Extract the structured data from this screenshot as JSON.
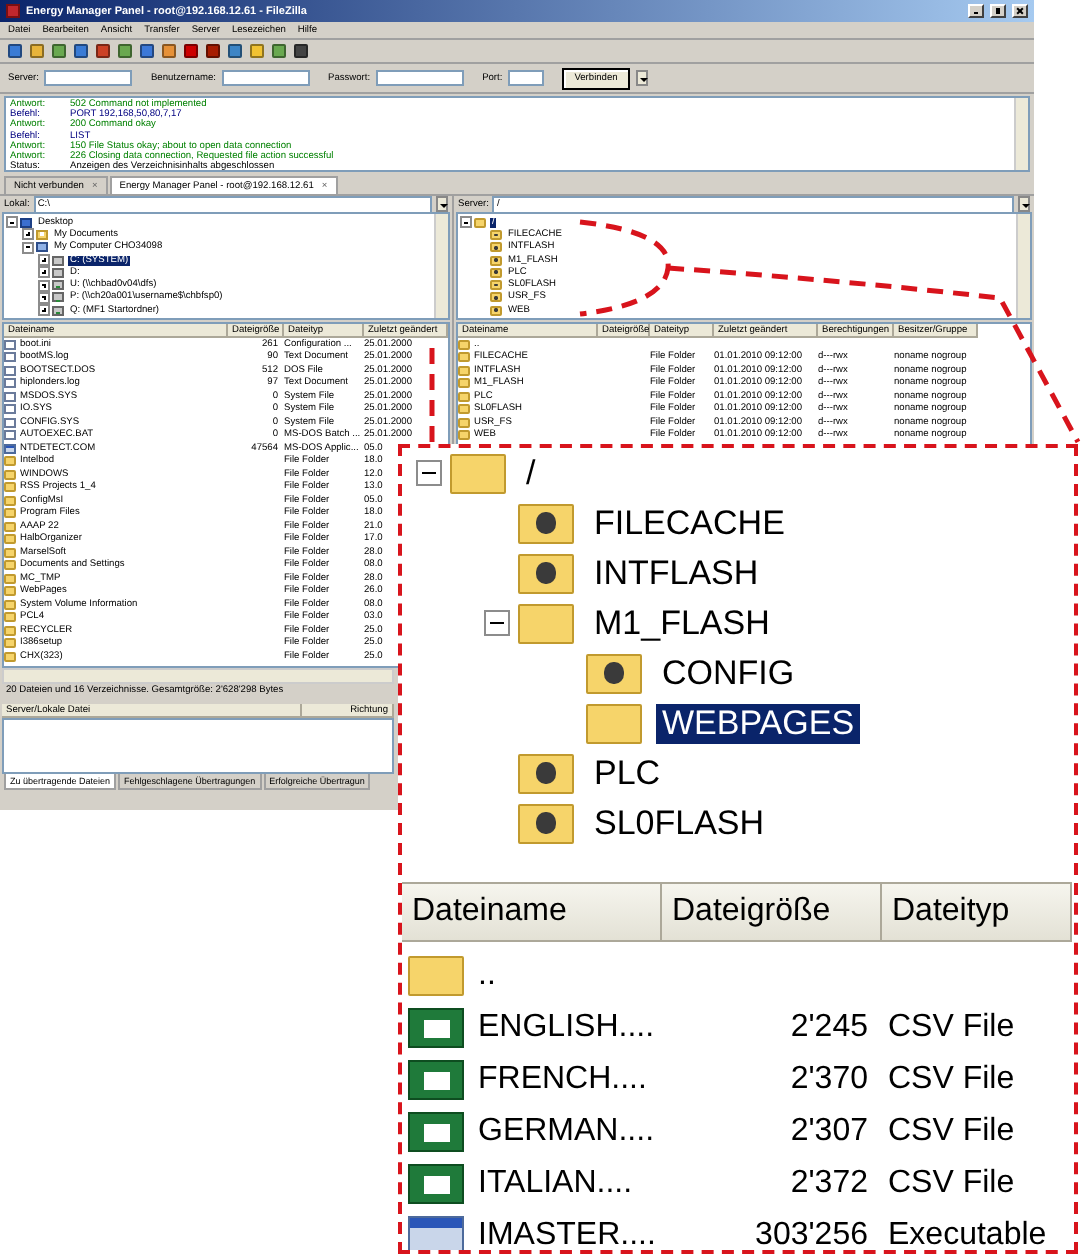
{
  "window": {
    "title": "Energy Manager Panel - root@192.168.12.61 - FileZilla"
  },
  "menu": [
    "Datei",
    "Bearbeiten",
    "Ansicht",
    "Transfer",
    "Server",
    "Lesezeichen",
    "Hilfe"
  ],
  "quickconnect": {
    "fields": [
      {
        "label": "Server:"
      },
      {
        "label": "Benutzername:"
      },
      {
        "label": "Passwort:"
      },
      {
        "label": "Port:"
      }
    ],
    "button": "Verbinden"
  },
  "log": [
    {
      "kind": "response",
      "label": "Antwort:",
      "text": "502 Command not implemented"
    },
    {
      "kind": "command",
      "label": "Befehl:",
      "text": "PORT 192,168,50,80,7,17"
    },
    {
      "kind": "response",
      "label": "Antwort:",
      "text": "200 Command okay"
    },
    {
      "kind": "command",
      "label": "Befehl:",
      "text": "LIST"
    },
    {
      "kind": "response",
      "label": "Antwort:",
      "text": "150 File Status okay; about to open data connection"
    },
    {
      "kind": "response",
      "label": "Antwort:",
      "text": "226 Closing data connection, Requested file action successful"
    },
    {
      "kind": "status",
      "label": "Status:",
      "text": "Anzeigen des Verzeichnisinhalts abgeschlossen"
    }
  ],
  "tabs": [
    {
      "label": "Nicht verbunden",
      "close": "×",
      "selected": false
    },
    {
      "label": "Energy Manager Panel - root@192.168.12.61",
      "close": "×",
      "selected": true
    }
  ],
  "local": {
    "label": "Lokal:",
    "path": "C:\\",
    "tree": [
      {
        "label": "Desktop",
        "kind": "desktop",
        "expanded": true,
        "selected": false,
        "children": [
          {
            "label": "My Documents",
            "kind": "documents",
            "expanded": false,
            "selected": false
          },
          {
            "label": "My Computer CHO34098",
            "kind": "computer",
            "expanded": true,
            "selected": false,
            "children": [
              {
                "label": "C: (SYSTEM)",
                "kind": "drive",
                "expanded": false,
                "selected": true
              },
              {
                "label": "D:",
                "kind": "drive",
                "expanded": false,
                "selected": false
              },
              {
                "label": "U: (\\\\chbad0v04\\dfs)",
                "kind": "network-drive",
                "expanded": false,
                "selected": false
              },
              {
                "label": "P: (\\\\ch20a001\\username$\\chbfsp0)",
                "kind": "network-drive",
                "expanded": false,
                "selected": false
              },
              {
                "label": "Q: (MF1 Startordner)",
                "kind": "network-drive",
                "expanded": false,
                "selected": false
              }
            ]
          }
        ]
      }
    ],
    "columns": [
      "Dateiname",
      "Dateigröße",
      "Dateityp",
      "Zuletzt geändert"
    ],
    "files": [
      {
        "kind": "file",
        "name": "boot.ini",
        "size": "261",
        "type": "Configuration ...",
        "modified": "25.01.2000"
      },
      {
        "kind": "file",
        "name": "bootMS.log",
        "size": "90",
        "type": "Text Document",
        "modified": "25.01.2000"
      },
      {
        "kind": "file",
        "name": "BOOTSECT.DOS",
        "size": "512",
        "type": "DOS File",
        "modified": "25.01.2000"
      },
      {
        "kind": "file",
        "name": "hiplonders.log",
        "size": "97",
        "type": "Text Document",
        "modified": "25.01.2000"
      },
      {
        "kind": "file",
        "name": "MSDOS.SYS",
        "size": "0",
        "type": "System File",
        "modified": "25.01.2000"
      },
      {
        "kind": "file",
        "name": "IO.SYS",
        "size": "0",
        "type": "System File",
        "modified": "25.01.2000"
      },
      {
        "kind": "file",
        "name": "CONFIG.SYS",
        "size": "0",
        "type": "System File",
        "modified": "25.01.2000"
      },
      {
        "kind": "file",
        "name": "AUTOEXEC.BAT",
        "size": "0",
        "type": "MS-DOS Batch ...",
        "modified": "25.01.2000"
      },
      {
        "kind": "program",
        "name": "NTDETECT.COM",
        "size": "47564",
        "type": "MS-DOS Applic...",
        "modified": "05.0"
      },
      {
        "kind": "folder",
        "name": "Intelbod",
        "type": "File Folder",
        "modified": "18.0"
      },
      {
        "kind": "folder",
        "name": "WINDOWS",
        "type": "File Folder",
        "modified": "12.0"
      },
      {
        "kind": "folder",
        "name": "RSS Projects 1_4",
        "type": "File Folder",
        "modified": "13.0"
      },
      {
        "kind": "folder",
        "name": "ConfigMsI",
        "type": "File Folder",
        "modified": "05.0"
      },
      {
        "kind": "folder",
        "name": "Program Files",
        "type": "File Folder",
        "modified": "18.0"
      },
      {
        "kind": "folder",
        "name": "AAAP 22",
        "type": "File Folder",
        "modified": "21.0"
      },
      {
        "kind": "folder",
        "name": "HalbOrganizer",
        "type": "File Folder",
        "modified": "17.0"
      },
      {
        "kind": "folder",
        "name": "MarselSoft",
        "type": "File Folder",
        "modified": "28.0"
      },
      {
        "kind": "folder",
        "name": "Documents and Settings",
        "type": "File Folder",
        "modified": "08.0"
      },
      {
        "kind": "folder",
        "name": "MC_TMP",
        "type": "File Folder",
        "modified": "28.0"
      },
      {
        "kind": "folder",
        "name": "WebPages",
        "type": "File Folder",
        "modified": "26.0"
      },
      {
        "kind": "folder",
        "name": "System Volume Information",
        "type": "File Folder",
        "modified": "08.0"
      },
      {
        "kind": "folder",
        "name": "PCL4",
        "type": "File Folder",
        "modified": "03.0"
      },
      {
        "kind": "folder",
        "name": "RECYCLER",
        "type": "File Folder",
        "modified": "25.0"
      },
      {
        "kind": "folder",
        "name": "I386setup",
        "type": "File Folder",
        "modified": "25.0"
      },
      {
        "kind": "folder",
        "name": "CHX(323)",
        "type": "File Folder",
        "modified": "25.0"
      }
    ],
    "status": "20 Dateien und 16 Verzeichnisse. Gesamtgröße: 2'628'298 Bytes"
  },
  "remote": {
    "label": "Server:",
    "path": "/",
    "tree": [
      {
        "label": "/",
        "kind": "folder",
        "expanded": true,
        "selected": true,
        "children": [
          {
            "label": "FILECACHE",
            "kind": "unknown-folder",
            "selected": false
          },
          {
            "label": "INTFLASH",
            "kind": "unknown-folder",
            "selected": false
          },
          {
            "label": "M1_FLASH",
            "kind": "unknown-folder",
            "selected": false
          },
          {
            "label": "PLC",
            "kind": "unknown-folder",
            "selected": false
          },
          {
            "label": "SL0FLASH",
            "kind": "unknown-folder",
            "selected": false
          },
          {
            "label": "USR_FS",
            "kind": "unknown-folder",
            "selected": false
          },
          {
            "label": "WEB",
            "kind": "unknown-folder",
            "selected": false
          }
        ]
      }
    ],
    "columns": [
      "Dateiname",
      "Dateigröße",
      "Dateityp",
      "Zuletzt geändert",
      "Berechtigungen",
      "Besitzer/Gruppe"
    ],
    "files": [
      {
        "kind": "folder",
        "name": ".."
      },
      {
        "kind": "folder",
        "name": "FILECACHE",
        "type": "File Folder",
        "modified": "01.01.2010 09:12:00",
        "permissions": "d---rwx",
        "owner": "noname nogroup"
      },
      {
        "kind": "folder",
        "name": "INTFLASH",
        "type": "File Folder",
        "modified": "01.01.2010 09:12:00",
        "permissions": "d---rwx",
        "owner": "noname nogroup"
      },
      {
        "kind": "folder",
        "name": "M1_FLASH",
        "type": "File Folder",
        "modified": "01.01.2010 09:12:00",
        "permissions": "d---rwx",
        "owner": "noname nogroup"
      },
      {
        "kind": "folder",
        "name": "PLC",
        "type": "File Folder",
        "modified": "01.01.2010 09:12:00",
        "permissions": "d---rwx",
        "owner": "noname nogroup"
      },
      {
        "kind": "folder",
        "name": "SL0FLASH",
        "type": "File Folder",
        "modified": "01.01.2010 09:12:00",
        "permissions": "d---rwx",
        "owner": "noname nogroup"
      },
      {
        "kind": "folder",
        "name": "USR_FS",
        "type": "File Folder",
        "modified": "01.01.2010 09:12:00",
        "permissions": "d---rwx",
        "owner": "noname nogroup"
      },
      {
        "kind": "folder",
        "name": "WEB",
        "type": "File Folder",
        "modified": "01.01.2010 09:12:00",
        "permissions": "d---rwx",
        "owner": "noname nogroup"
      }
    ]
  },
  "queue": {
    "columns": [
      "Server/Lokale Datei",
      "Richtung"
    ],
    "tabs": [
      {
        "label": "Zu übertragende Dateien",
        "selected": true
      },
      {
        "label": "Fehlgeschlagene Übertragungen",
        "selected": false
      },
      {
        "label": "Erfolgreiche Übertragun",
        "selected": false
      }
    ]
  },
  "callout": {
    "tree": [
      {
        "label": "/",
        "kind": "folder",
        "expanded": true,
        "selected": false,
        "children": [
          {
            "label": "FILECACHE",
            "kind": "unknown-folder",
            "selected": false
          },
          {
            "label": "INTFLASH",
            "kind": "unknown-folder",
            "selected": false
          },
          {
            "label": "M1_FLASH",
            "kind": "folder",
            "expanded": true,
            "selected": false,
            "children": [
              {
                "label": "CONFIG",
                "kind": "unknown-folder",
                "selected": false
              },
              {
                "label": "WEBPAGES",
                "kind": "folder",
                "selected": true
              }
            ]
          },
          {
            "label": "PLC",
            "kind": "unknown-folder",
            "selected": false
          },
          {
            "label": "SL0FLASH",
            "kind": "unknown-folder",
            "selected": false
          }
        ]
      }
    ],
    "columns": [
      "Dateiname",
      "Dateigröße",
      "Dateityp"
    ],
    "files": [
      {
        "kind": "folder",
        "name": ".."
      },
      {
        "kind": "spreadsheet",
        "name": "ENGLISH....",
        "size": "2'245",
        "type": "CSV File"
      },
      {
        "kind": "spreadsheet",
        "name": "FRENCH....",
        "size": "2'370",
        "type": "CSV File"
      },
      {
        "kind": "spreadsheet",
        "name": "GERMAN....",
        "size": "2'307",
        "type": "CSV File"
      },
      {
        "kind": "spreadsheet",
        "name": "ITALIAN....",
        "size": "2'372",
        "type": "CSV File"
      },
      {
        "kind": "program",
        "name": "IMASTER....",
        "size": "303'256",
        "type": "Executable"
      }
    ]
  }
}
